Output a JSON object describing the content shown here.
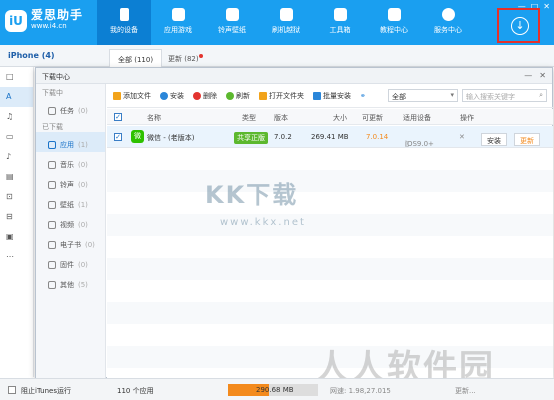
{
  "app": {
    "logo_mark": "iU",
    "logo_title": "爱思助手",
    "logo_url": "www.i4.cn"
  },
  "nav": [
    {
      "label": "我的设备",
      "icon": "phone-icon"
    },
    {
      "label": "应用游戏",
      "icon": "apps-icon"
    },
    {
      "label": "铃声壁纸",
      "icon": "music-icon"
    },
    {
      "label": "刷机越狱",
      "icon": "shield-icon"
    },
    {
      "label": "工具箱",
      "icon": "toolbox-icon"
    },
    {
      "label": "教程中心",
      "icon": "graduation-icon"
    },
    {
      "label": "服务中心",
      "icon": "compass-icon"
    }
  ],
  "window_controls": {
    "min": "—",
    "max": "□",
    "close": "✕"
  },
  "download_glyph": "↓",
  "device_bar": {
    "device": "iPhone (4)",
    "tabs": [
      {
        "label": "全部 (110)"
      },
      {
        "label": "更新 (82)"
      }
    ]
  },
  "left_strip": [
    "□",
    "A",
    "♫",
    "▭",
    "♪",
    "▤",
    "⊡",
    "⊟",
    "▣",
    "⋯"
  ],
  "download_center": {
    "title": "下载中心",
    "controls": {
      "min": "—",
      "close": "✕"
    },
    "sections": {
      "downloading": "下载中",
      "downloaded": "已下载"
    },
    "task": {
      "label": "任务",
      "count": "(0)"
    },
    "items": [
      {
        "label": "应用",
        "count": "(1)"
      },
      {
        "label": "音乐",
        "count": "(0)"
      },
      {
        "label": "铃声",
        "count": "(0)"
      },
      {
        "label": "壁纸",
        "count": "(1)"
      },
      {
        "label": "视频",
        "count": "(0)"
      },
      {
        "label": "电子书",
        "count": "(0)"
      },
      {
        "label": "固件",
        "count": "(0)"
      },
      {
        "label": "其他",
        "count": "(5)"
      }
    ],
    "toolbar": {
      "add": "添加文件",
      "install": "安装",
      "delete": "删除",
      "refresh": "刷新",
      "open_folder": "打开文件夹",
      "batch_install": "批量安装",
      "filter_value": "全部",
      "search_placeholder": "输入搜索关键字"
    },
    "columns": [
      "名称",
      "类型",
      "版本",
      "大小",
      "可更新",
      "适用设备",
      "操作"
    ],
    "row": {
      "icon_text": "微",
      "name": "微信 - (老版本)",
      "type": "共享正版",
      "version": "7.0.2",
      "size": "269.41 MB",
      "updatable": "7.0.14",
      "device": "iOS9.0+",
      "remove": "✕",
      "install": "安装",
      "update": "更新"
    }
  },
  "watermarks": {
    "main": "KK下载",
    "sub": "www.kkx.net",
    "corner": "人人软件园"
  },
  "status": {
    "itunes": "阻止iTunes运行",
    "count": "110 个应用",
    "storage": "290.68 MB",
    "storage_fill": 0.45,
    "extra1": "网速: 1.98,27.015",
    "extra2": "更新..."
  }
}
